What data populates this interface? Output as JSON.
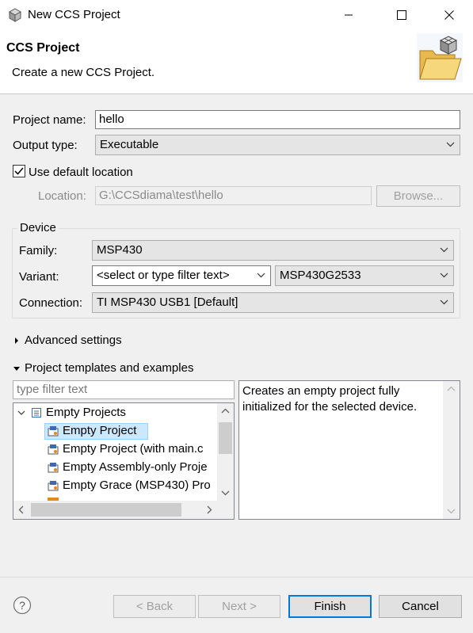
{
  "window": {
    "title": "New CCS Project",
    "minimize_icon": "minimize-icon",
    "maximize_icon": "maximize-icon",
    "close_icon": "close-icon"
  },
  "header": {
    "title": "CCS Project",
    "description": "Create a new CCS Project."
  },
  "project": {
    "name_label": "Project name:",
    "name_value": "hello",
    "output_label": "Output type:",
    "output_value": "Executable",
    "use_default_label": "Use default location",
    "use_default_checked": true,
    "location_label": "Location:",
    "location_value": "G:\\CCSdiama\\test\\hello",
    "browse_label": "Browse..."
  },
  "device": {
    "group_label": "Device",
    "family_label": "Family:",
    "family_value": "MSP430",
    "variant_label": "Variant:",
    "variant_filter_value": "<select or type filter text>",
    "variant_value": "MSP430G2533",
    "connection_label": "Connection:",
    "connection_value": "TI MSP430 USB1 [Default]"
  },
  "advanced": {
    "label": "Advanced settings"
  },
  "templates": {
    "label": "Project templates and examples",
    "filter_placeholder": "type filter text",
    "tree": {
      "root_label": "Empty Projects",
      "items": [
        {
          "label": "Empty Project",
          "selected": true
        },
        {
          "label": "Empty Project (with main.c"
        },
        {
          "label": "Empty Assembly-only Proje"
        },
        {
          "label": "Empty Grace (MSP430) Pro"
        }
      ]
    },
    "description": "Creates an empty project fully initialized for the selected device."
  },
  "footer": {
    "help_icon": "help-icon",
    "back_label": "< Back",
    "next_label": "Next >",
    "finish_label": "Finish",
    "cancel_label": "Cancel"
  }
}
